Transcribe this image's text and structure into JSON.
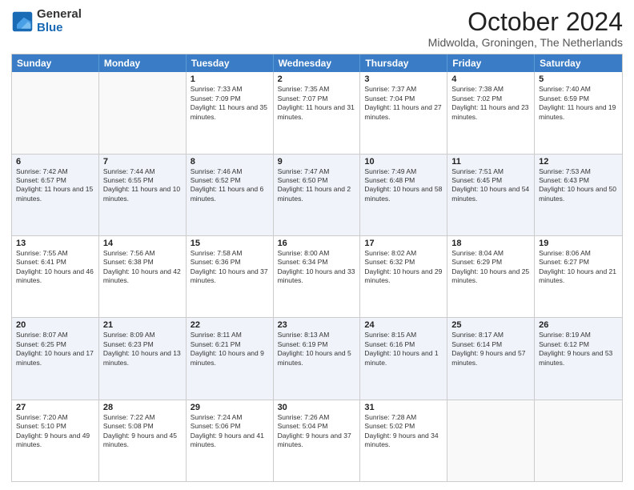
{
  "header": {
    "logo": {
      "general": "General",
      "blue": "Blue"
    },
    "title": "October 2024",
    "location": "Midwolda, Groningen, The Netherlands"
  },
  "days": [
    "Sunday",
    "Monday",
    "Tuesday",
    "Wednesday",
    "Thursday",
    "Friday",
    "Saturday"
  ],
  "weeks": [
    [
      {
        "day": "",
        "sunrise": "",
        "sunset": "",
        "daylight": "",
        "empty": true
      },
      {
        "day": "",
        "sunrise": "",
        "sunset": "",
        "daylight": "",
        "empty": true
      },
      {
        "day": "1",
        "sunrise": "Sunrise: 7:33 AM",
        "sunset": "Sunset: 7:09 PM",
        "daylight": "Daylight: 11 hours and 35 minutes."
      },
      {
        "day": "2",
        "sunrise": "Sunrise: 7:35 AM",
        "sunset": "Sunset: 7:07 PM",
        "daylight": "Daylight: 11 hours and 31 minutes."
      },
      {
        "day": "3",
        "sunrise": "Sunrise: 7:37 AM",
        "sunset": "Sunset: 7:04 PM",
        "daylight": "Daylight: 11 hours and 27 minutes."
      },
      {
        "day": "4",
        "sunrise": "Sunrise: 7:38 AM",
        "sunset": "Sunset: 7:02 PM",
        "daylight": "Daylight: 11 hours and 23 minutes."
      },
      {
        "day": "5",
        "sunrise": "Sunrise: 7:40 AM",
        "sunset": "Sunset: 6:59 PM",
        "daylight": "Daylight: 11 hours and 19 minutes."
      }
    ],
    [
      {
        "day": "6",
        "sunrise": "Sunrise: 7:42 AM",
        "sunset": "Sunset: 6:57 PM",
        "daylight": "Daylight: 11 hours and 15 minutes."
      },
      {
        "day": "7",
        "sunrise": "Sunrise: 7:44 AM",
        "sunset": "Sunset: 6:55 PM",
        "daylight": "Daylight: 11 hours and 10 minutes."
      },
      {
        "day": "8",
        "sunrise": "Sunrise: 7:46 AM",
        "sunset": "Sunset: 6:52 PM",
        "daylight": "Daylight: 11 hours and 6 minutes."
      },
      {
        "day": "9",
        "sunrise": "Sunrise: 7:47 AM",
        "sunset": "Sunset: 6:50 PM",
        "daylight": "Daylight: 11 hours and 2 minutes."
      },
      {
        "day": "10",
        "sunrise": "Sunrise: 7:49 AM",
        "sunset": "Sunset: 6:48 PM",
        "daylight": "Daylight: 10 hours and 58 minutes."
      },
      {
        "day": "11",
        "sunrise": "Sunrise: 7:51 AM",
        "sunset": "Sunset: 6:45 PM",
        "daylight": "Daylight: 10 hours and 54 minutes."
      },
      {
        "day": "12",
        "sunrise": "Sunrise: 7:53 AM",
        "sunset": "Sunset: 6:43 PM",
        "daylight": "Daylight: 10 hours and 50 minutes."
      }
    ],
    [
      {
        "day": "13",
        "sunrise": "Sunrise: 7:55 AM",
        "sunset": "Sunset: 6:41 PM",
        "daylight": "Daylight: 10 hours and 46 minutes."
      },
      {
        "day": "14",
        "sunrise": "Sunrise: 7:56 AM",
        "sunset": "Sunset: 6:38 PM",
        "daylight": "Daylight: 10 hours and 42 minutes."
      },
      {
        "day": "15",
        "sunrise": "Sunrise: 7:58 AM",
        "sunset": "Sunset: 6:36 PM",
        "daylight": "Daylight: 10 hours and 37 minutes."
      },
      {
        "day": "16",
        "sunrise": "Sunrise: 8:00 AM",
        "sunset": "Sunset: 6:34 PM",
        "daylight": "Daylight: 10 hours and 33 minutes."
      },
      {
        "day": "17",
        "sunrise": "Sunrise: 8:02 AM",
        "sunset": "Sunset: 6:32 PM",
        "daylight": "Daylight: 10 hours and 29 minutes."
      },
      {
        "day": "18",
        "sunrise": "Sunrise: 8:04 AM",
        "sunset": "Sunset: 6:29 PM",
        "daylight": "Daylight: 10 hours and 25 minutes."
      },
      {
        "day": "19",
        "sunrise": "Sunrise: 8:06 AM",
        "sunset": "Sunset: 6:27 PM",
        "daylight": "Daylight: 10 hours and 21 minutes."
      }
    ],
    [
      {
        "day": "20",
        "sunrise": "Sunrise: 8:07 AM",
        "sunset": "Sunset: 6:25 PM",
        "daylight": "Daylight: 10 hours and 17 minutes."
      },
      {
        "day": "21",
        "sunrise": "Sunrise: 8:09 AM",
        "sunset": "Sunset: 6:23 PM",
        "daylight": "Daylight: 10 hours and 13 minutes."
      },
      {
        "day": "22",
        "sunrise": "Sunrise: 8:11 AM",
        "sunset": "Sunset: 6:21 PM",
        "daylight": "Daylight: 10 hours and 9 minutes."
      },
      {
        "day": "23",
        "sunrise": "Sunrise: 8:13 AM",
        "sunset": "Sunset: 6:19 PM",
        "daylight": "Daylight: 10 hours and 5 minutes."
      },
      {
        "day": "24",
        "sunrise": "Sunrise: 8:15 AM",
        "sunset": "Sunset: 6:16 PM",
        "daylight": "Daylight: 10 hours and 1 minute."
      },
      {
        "day": "25",
        "sunrise": "Sunrise: 8:17 AM",
        "sunset": "Sunset: 6:14 PM",
        "daylight": "Daylight: 9 hours and 57 minutes."
      },
      {
        "day": "26",
        "sunrise": "Sunrise: 8:19 AM",
        "sunset": "Sunset: 6:12 PM",
        "daylight": "Daylight: 9 hours and 53 minutes."
      }
    ],
    [
      {
        "day": "27",
        "sunrise": "Sunrise: 7:20 AM",
        "sunset": "Sunset: 5:10 PM",
        "daylight": "Daylight: 9 hours and 49 minutes."
      },
      {
        "day": "28",
        "sunrise": "Sunrise: 7:22 AM",
        "sunset": "Sunset: 5:08 PM",
        "daylight": "Daylight: 9 hours and 45 minutes."
      },
      {
        "day": "29",
        "sunrise": "Sunrise: 7:24 AM",
        "sunset": "Sunset: 5:06 PM",
        "daylight": "Daylight: 9 hours and 41 minutes."
      },
      {
        "day": "30",
        "sunrise": "Sunrise: 7:26 AM",
        "sunset": "Sunset: 5:04 PM",
        "daylight": "Daylight: 9 hours and 37 minutes."
      },
      {
        "day": "31",
        "sunrise": "Sunrise: 7:28 AM",
        "sunset": "Sunset: 5:02 PM",
        "daylight": "Daylight: 9 hours and 34 minutes."
      },
      {
        "day": "",
        "sunrise": "",
        "sunset": "",
        "daylight": "",
        "empty": true
      },
      {
        "day": "",
        "sunrise": "",
        "sunset": "",
        "daylight": "",
        "empty": true
      }
    ]
  ]
}
